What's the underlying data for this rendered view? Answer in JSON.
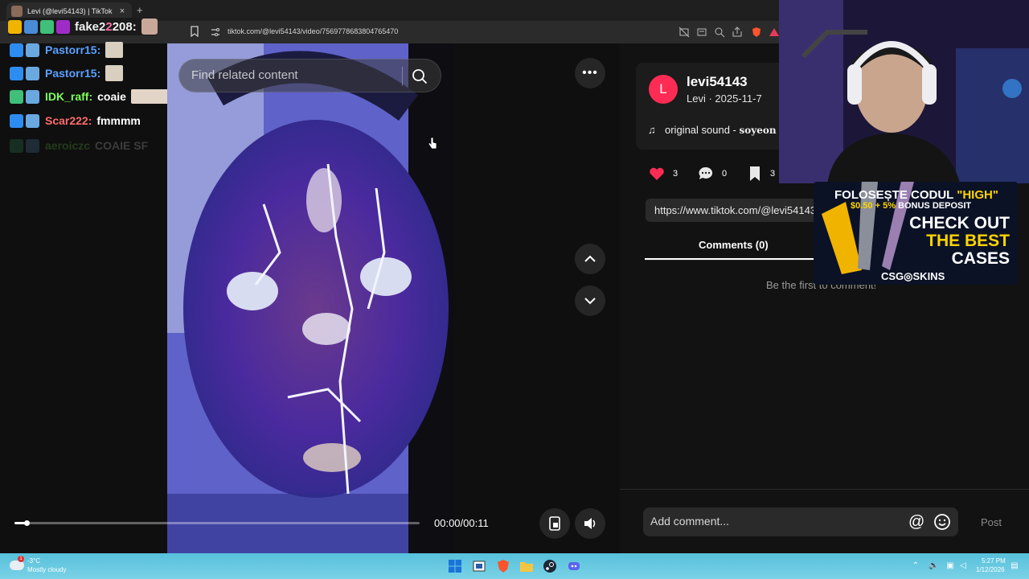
{
  "browser": {
    "tab_title": "Levi (@levi54143) | TikTok",
    "tab_close": "×",
    "new_tab": "+",
    "url": "tiktok.com/@levi54143/video/7569778683804765470"
  },
  "chat": {
    "top": {
      "name_prefix": "fake2",
      "name_pink": "2",
      "name_suffix": "208:"
    },
    "lines": [
      {
        "user": "Pastorr15:",
        "color": "#5aa0ff",
        "msg": ""
      },
      {
        "user": "Pastorr15:",
        "color": "#5aa0ff",
        "msg": ""
      },
      {
        "user": "IDK_raff:",
        "color": "#7cff5a",
        "msg": "coaie"
      },
      {
        "user": "Scar222:",
        "color": "#ff6b6b",
        "msg": "fmmmm"
      },
      {
        "user": "aeroiczc",
        "color": "#7cff5a",
        "msg": "COAIE SF"
      }
    ]
  },
  "video": {
    "search_placeholder": "Find related content",
    "more_label": "•••",
    "time": "00:00/00:11",
    "progress_fraction": 0.03
  },
  "details": {
    "avatar_letter": "L",
    "username": "levi54143",
    "meta": "Levi · 2025-11-7",
    "music_icon": "♫",
    "sound_label": "original sound -",
    "sound_artist": "soyeon",
    "likes": "3",
    "comments": "0",
    "saves": "3",
    "link": "https://www.tiktok.com/@levi54143/video/7569778683804765470",
    "comments_tab": "Comments (0)",
    "empty_comments": "Be the first to comment!",
    "comment_placeholder": "Add comment...",
    "at_symbol": "@",
    "post": "Post"
  },
  "ad": {
    "line1_a": "FOLOSEȘTE CODUL ",
    "line1_b": "\"HIGH\"",
    "line2_a": "$0.50 + ",
    "line2_b": "5%",
    "line2_c": " BONUS DEPOSIT",
    "line3": "CHECK OUT",
    "line4": "THE BEST",
    "line5": "CASES",
    "brand": "CSG◎SKINS"
  },
  "taskbar": {
    "weather_badge": "1",
    "temp": "-3°C",
    "weather": "Mostly cloudy",
    "time": "5:27 PM",
    "date": "1/12/2026"
  }
}
